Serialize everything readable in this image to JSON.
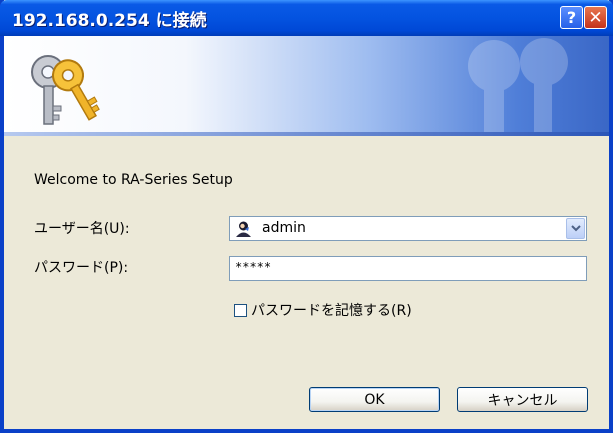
{
  "window": {
    "title": "192.168.0.254 に接続"
  },
  "titlebar": {
    "help_label": "?",
    "close_label": "✕"
  },
  "icons": {
    "banner": "keys-icon",
    "user": "user-icon",
    "dropdown": "chevron-down-icon"
  },
  "message": "Welcome to RA-Series Setup",
  "form": {
    "username_label": "ユーザー名(U):",
    "username_value": "admin",
    "password_label": "パスワード(P):",
    "password_value": "*****",
    "remember_label": "パスワードを記憶する(R)",
    "remember_checked": false
  },
  "buttons": {
    "ok": "OK",
    "cancel": "キャンセル"
  },
  "colors": {
    "titlebar": "#0453e0",
    "window_bg": "#ece9d8",
    "field_border": "#7f9db9"
  }
}
